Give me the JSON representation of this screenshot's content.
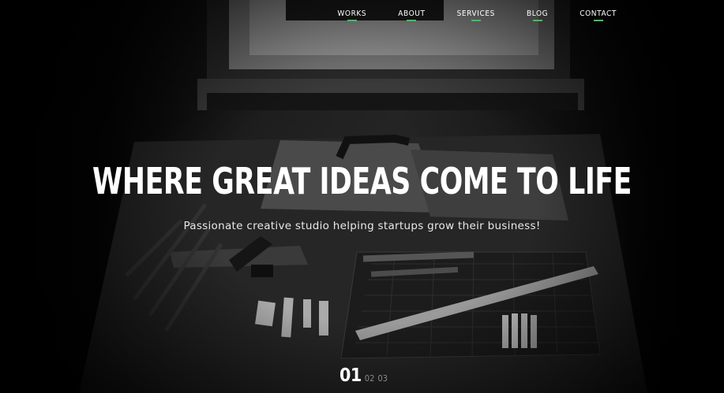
{
  "nav": {
    "items": [
      {
        "label": "WORKS"
      },
      {
        "label": "ABOUT"
      },
      {
        "label": "SERVICES"
      },
      {
        "label": "BLOG"
      },
      {
        "label": "CONTACT"
      }
    ],
    "accent_color": "#3fbf5a"
  },
  "hero": {
    "title": "WHERE GREAT IDEAS COME TO LIFE",
    "subtitle": "Passionate creative studio helping startups grow their business!"
  },
  "pager": {
    "current": "01",
    "others": [
      "02",
      "03"
    ]
  }
}
